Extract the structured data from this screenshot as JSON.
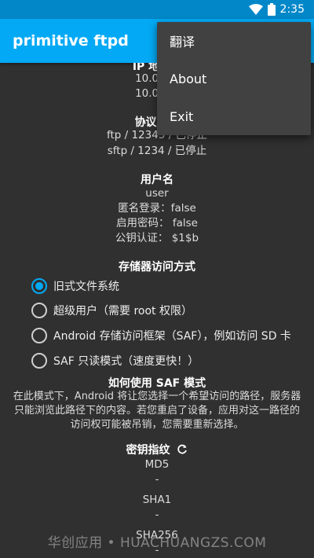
{
  "status_bar": {
    "time": "2:35",
    "wifi_icon": "wifi-icon",
    "battery_icon": "battery-icon"
  },
  "app_bar": {
    "title": "primitive ftpd"
  },
  "overflow_menu": {
    "items": [
      "翻译",
      "About",
      "Exit"
    ]
  },
  "ip_section": {
    "title": "IP 地址（",
    "addresses": [
      "10.0.3.1",
      "10.0.2.1"
    ]
  },
  "protocol_section": {
    "title": "协议 / 端",
    "lines": [
      "ftp / 12345 / 已停止",
      "sftp / 1234 / 已停止"
    ]
  },
  "user_section": {
    "title": "用户名",
    "lines": [
      "user",
      "匿名登录：false",
      "启用密码： false",
      "公钥认证：  $1$b"
    ]
  },
  "storage_section": {
    "title": "存储器访问方式",
    "options": [
      {
        "label": "旧式文件系统",
        "checked": true
      },
      {
        "label": "超级用户（需要 root 权限）",
        "checked": false
      },
      {
        "label": "Android 存储访问框架（SAF），例如访问 SD 卡",
        "checked": false
      },
      {
        "label": "SAF 只读模式（速度更快！）",
        "checked": false
      }
    ]
  },
  "saf_help": {
    "title": "如何使用 SAF 模式",
    "lines": [
      "在此模式下，Android 将让您选择一个希望访问的路径，服务器",
      "只能浏览此路径下的内容。若您重启了设备，应用对这一路径的",
      "访问权可能被吊销，您需要重新选择。"
    ]
  },
  "fingerprints": {
    "title": "密钥指纹",
    "refresh_icon": "refresh-icon",
    "lines": [
      "MD5",
      "-",
      "SHA1",
      "-",
      "SHA256",
      "-"
    ]
  },
  "watermark": "华创应用 • HUACHUANGZS.COM"
}
